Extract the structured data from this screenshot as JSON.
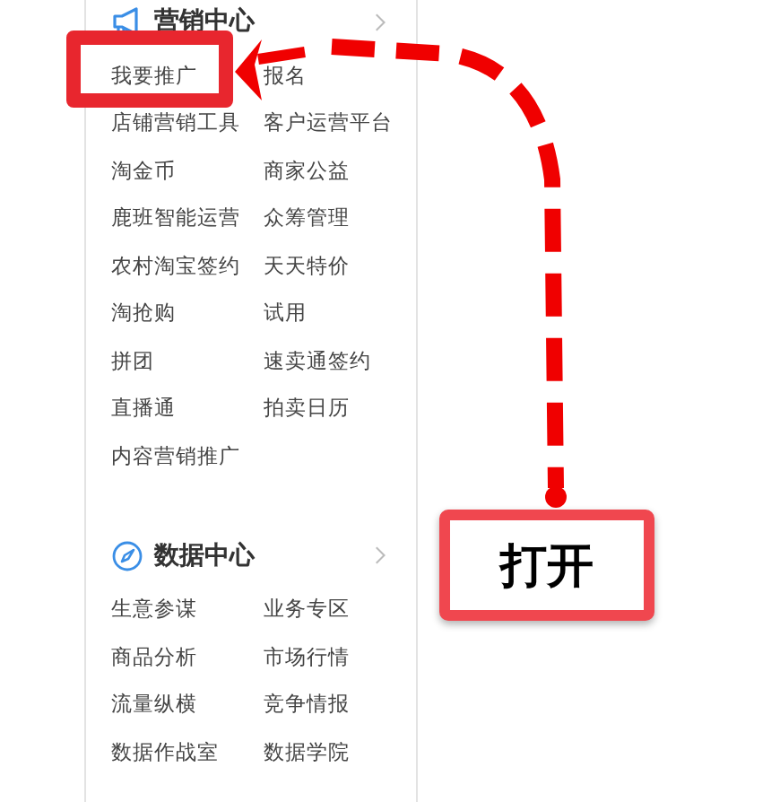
{
  "sections": [
    {
      "title": "营销中心",
      "kind": "marketing",
      "items": [
        {
          "label": "我要推广",
          "highlighted": true
        },
        {
          "label": "报名",
          "highlighted": false
        },
        {
          "label": "店铺营销工具",
          "highlighted": false
        },
        {
          "label": "客户运营平台",
          "highlighted": false
        },
        {
          "label": "淘金币",
          "highlighted": false
        },
        {
          "label": "商家公益",
          "highlighted": false
        },
        {
          "label": "鹿班智能运营",
          "highlighted": false
        },
        {
          "label": "众筹管理",
          "highlighted": false
        },
        {
          "label": "农村淘宝签约",
          "highlighted": false
        },
        {
          "label": "天天特价",
          "highlighted": false
        },
        {
          "label": "淘抢购",
          "highlighted": false
        },
        {
          "label": "试用",
          "highlighted": false
        },
        {
          "label": "拼团",
          "highlighted": false
        },
        {
          "label": "速卖通签约",
          "highlighted": false
        },
        {
          "label": "直播通",
          "highlighted": false
        },
        {
          "label": "拍卖日历",
          "highlighted": false
        },
        {
          "label": "内容营销推广",
          "highlighted": false
        }
      ]
    },
    {
      "title": "数据中心",
      "kind": "data",
      "items": [
        {
          "label": "生意参谋",
          "highlighted": false
        },
        {
          "label": "业务专区",
          "highlighted": false
        },
        {
          "label": "商品分析",
          "highlighted": false
        },
        {
          "label": "市场行情",
          "highlighted": false
        },
        {
          "label": "流量纵横",
          "highlighted": false
        },
        {
          "label": "竞争情报",
          "highlighted": false
        },
        {
          "label": "数据作战室",
          "highlighted": false
        },
        {
          "label": "数据学院",
          "highlighted": false
        }
      ]
    }
  ],
  "annotation": {
    "label": "打开"
  }
}
